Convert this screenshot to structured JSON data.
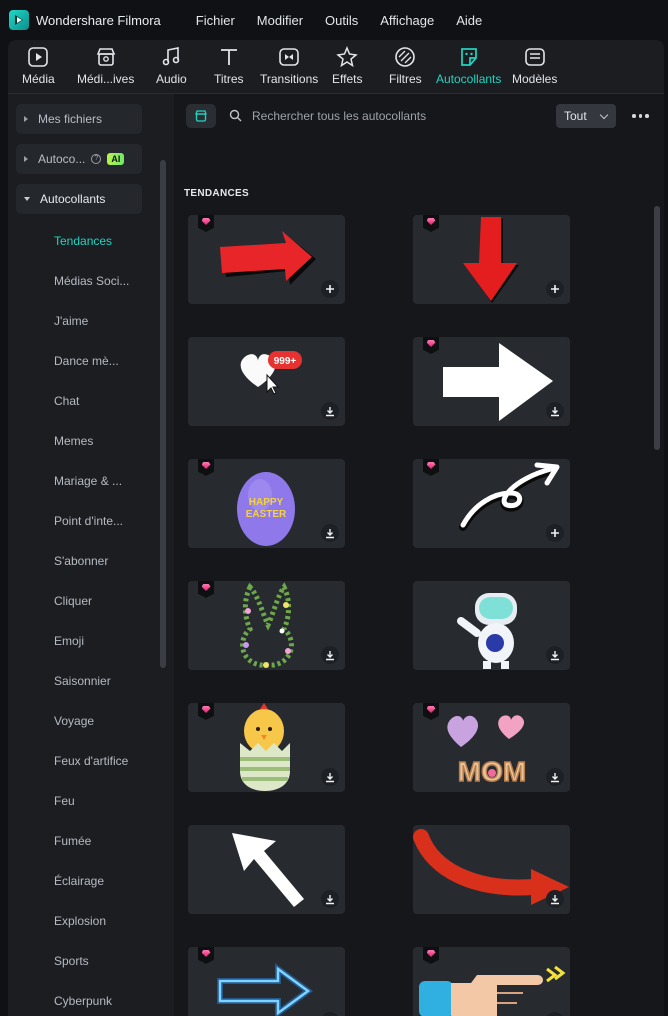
{
  "app": {
    "name": "Wondershare Filmora"
  },
  "menu": [
    "Fichier",
    "Modifier",
    "Outils",
    "Affichage",
    "Aide"
  ],
  "tabs": [
    {
      "label": "Média",
      "icon": "media-icon"
    },
    {
      "label": "Médi...ives",
      "icon": "stock-media-icon"
    },
    {
      "label": "Audio",
      "icon": "music-note-icon"
    },
    {
      "label": "Titres",
      "icon": "text-title-icon"
    },
    {
      "label": "Transitions",
      "icon": "transitions-icon"
    },
    {
      "label": "Effets",
      "icon": "effects-icon"
    },
    {
      "label": "Filtres",
      "icon": "filters-icon"
    },
    {
      "label": "Autocollants",
      "icon": "sticker-icon",
      "active": true
    },
    {
      "label": "Modèles",
      "icon": "templates-icon"
    }
  ],
  "sidebar": {
    "groups": [
      {
        "label": "Mes fichiers",
        "expanded": false
      },
      {
        "label": "Autoco...",
        "expanded": false,
        "badge": "AI"
      },
      {
        "label": "Autocollants",
        "expanded": true
      }
    ],
    "items": [
      "Tendances",
      "Médias Soci...",
      "J'aime",
      "Dance mè...",
      "Chat",
      "Memes",
      "Mariage & ...",
      "Point d'inte...",
      "S'abonner",
      "Cliquer",
      "Emoji",
      "Saisonnier",
      "Voyage",
      "Feux d'artifice",
      "Feu",
      "Fumée",
      "Éclairage",
      "Explosion",
      "Sports",
      "Cyberpunk"
    ],
    "active_item": "Tendances"
  },
  "search": {
    "placeholder": "Rechercher tous les autocollants",
    "value": ""
  },
  "filter": {
    "selected": "Tout"
  },
  "section": {
    "title": "TENDANCES"
  },
  "stickers": [
    {
      "name": "red-arrow-right",
      "premium": true,
      "action": "add"
    },
    {
      "name": "red-arrow-down",
      "premium": true,
      "action": "add"
    },
    {
      "name": "heart-999-plus",
      "premium": false,
      "action": "download",
      "text": "999+"
    },
    {
      "name": "white-arrow-right",
      "premium": true,
      "action": "download"
    },
    {
      "name": "happy-easter-egg",
      "premium": true,
      "action": "download",
      "text": "HAPPY EASTER"
    },
    {
      "name": "curly-white-arrow",
      "premium": true,
      "action": "add"
    },
    {
      "name": "flower-bunny",
      "premium": true,
      "action": "download"
    },
    {
      "name": "astronaut",
      "premium": false,
      "action": "download"
    },
    {
      "name": "chick-in-egg",
      "premium": true,
      "action": "download"
    },
    {
      "name": "mom-balloons",
      "premium": true,
      "action": "download",
      "text": "MOM"
    },
    {
      "name": "white-arrow-up-left",
      "premium": false,
      "action": "download"
    },
    {
      "name": "red-curved-arrow",
      "premium": false,
      "action": "download"
    },
    {
      "name": "neon-blue-arrow",
      "premium": true,
      "action": "download"
    },
    {
      "name": "pointing-hand",
      "premium": true,
      "action": "download"
    }
  ],
  "colors": {
    "accent": "#20d5c0",
    "background": "#1b1d21",
    "card": "#272b30"
  }
}
